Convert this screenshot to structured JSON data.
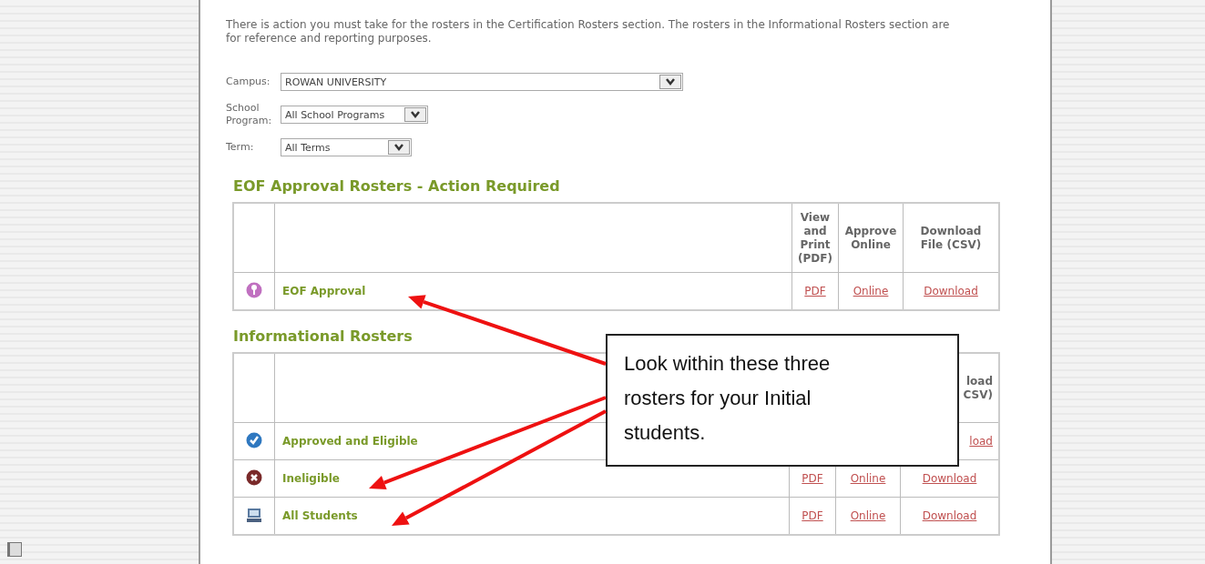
{
  "intro": "There is action you must take for the rosters in the Certification Rosters section. The rosters in the Informational Rosters section are for reference and reporting purposes.",
  "filters": [
    {
      "label": "Campus:",
      "value": "ROWAN UNIVERSITY"
    },
    {
      "label": "School Program:",
      "value": "All School Programs"
    },
    {
      "label": "Term:",
      "value": "All Terms"
    }
  ],
  "sections": [
    {
      "title": "EOF Approval Rosters - Action Required",
      "columns": {
        "pdf": [
          "View",
          "and",
          "Print",
          "(PDF)"
        ],
        "online": [
          "Approve",
          "Online"
        ],
        "download": [
          "Download",
          "File (CSV)"
        ]
      },
      "rows": [
        {
          "kind": "pending",
          "name": "EOF Approval",
          "pdf": "PDF",
          "online": "Online",
          "download": "Download"
        }
      ]
    },
    {
      "title": "Informational Rosters",
      "columns": {
        "download": [
          "load",
          "CSV)"
        ]
      },
      "rows": [
        {
          "kind": "approved",
          "name": "Approved and Eligible",
          "download": "load"
        },
        {
          "kind": "ineligible",
          "name": "Ineligible",
          "pdf": "PDF",
          "online": "Online",
          "download": "Download"
        },
        {
          "kind": "all",
          "name": "All Students",
          "pdf": "PDF",
          "online": "Online",
          "download": "Download"
        }
      ]
    }
  ],
  "callout": {
    "text": "Look within these three rosters for your Initial students."
  }
}
